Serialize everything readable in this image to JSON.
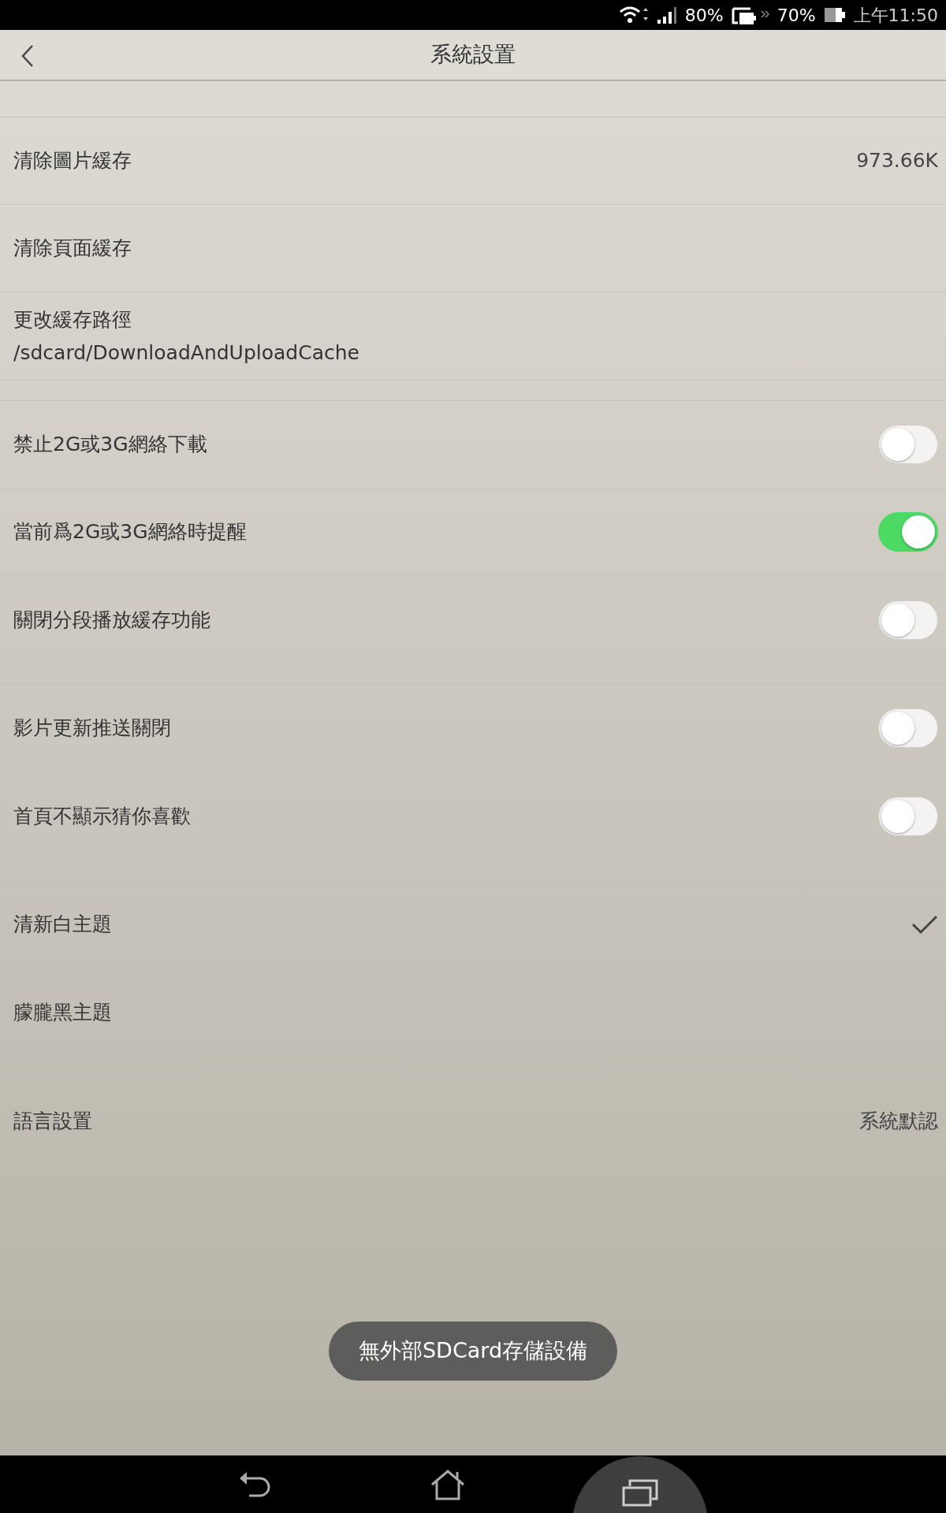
{
  "status_bar": {
    "phone_battery": "80%",
    "tablet_battery": "70%",
    "time": "上午11:50"
  },
  "header": {
    "title": "系統設置"
  },
  "groups": [
    {
      "items": [
        {
          "kind": "value",
          "label": "清除圖片緩存",
          "value": "973.66K"
        },
        {
          "kind": "plain",
          "label": "清除頁面緩存"
        },
        {
          "kind": "path",
          "label": "更改緩存路徑",
          "path": "/sdcard/DownloadAndUploadCache"
        }
      ]
    },
    {
      "items": [
        {
          "kind": "toggle",
          "label": "禁止2G或3G網絡下載",
          "on": false
        },
        {
          "kind": "toggle",
          "label": "當前爲2G或3G網絡時提醒",
          "on": true
        },
        {
          "kind": "toggle",
          "label": "關閉分段播放緩存功能",
          "on": false
        }
      ]
    },
    {
      "items": [
        {
          "kind": "toggle",
          "label": "影片更新推送關閉",
          "on": false
        },
        {
          "kind": "toggle",
          "label": "首頁不顯示猜你喜歡",
          "on": false
        }
      ]
    },
    {
      "items": [
        {
          "kind": "check",
          "label": "清新白主題",
          "selected": true
        },
        {
          "kind": "check",
          "label": "朦朧黑主題",
          "selected": false
        }
      ]
    },
    {
      "items": [
        {
          "kind": "value",
          "label": "語言設置",
          "value": "系統默認"
        }
      ]
    }
  ],
  "toast": "無外部SDCard存儲設備"
}
